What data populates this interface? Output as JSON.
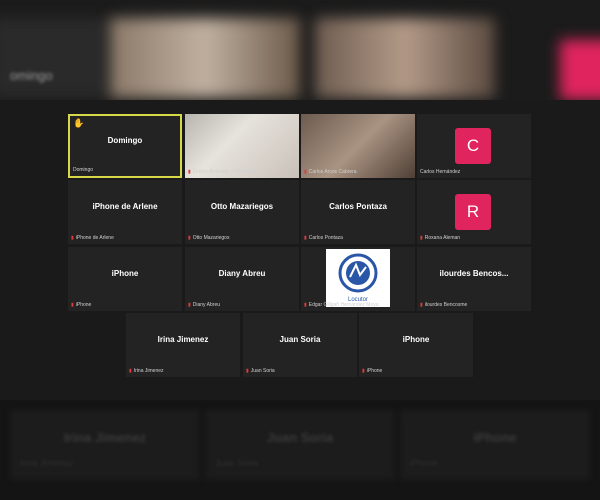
{
  "background_top": {
    "label": "omingo"
  },
  "background_bottom": {
    "tiles": [
      {
        "name": "Irina Jimenez",
        "label": "Irina Jimenez"
      },
      {
        "name": "Juan Soria",
        "label": "Juan Soria"
      },
      {
        "name": "iPhone",
        "label": "iPhone"
      }
    ]
  },
  "participants": [
    {
      "name": "Domingo",
      "label": "Domingo",
      "active": true,
      "hand": true
    },
    {
      "name": "",
      "label": "Evelyn Alvarado - CNAI UEB",
      "video": "a"
    },
    {
      "name": "",
      "label": "Carlos Arcos Cabrera",
      "video": "b"
    },
    {
      "name": "",
      "label": "Carlos Hernández",
      "avatar": "C"
    },
    {
      "name": "iPhone de Arlene",
      "label": "iPhone de Arlene"
    },
    {
      "name": "Otto Mazariegos",
      "label": "Otto Mazariegos"
    },
    {
      "name": "Carlos Pontaza",
      "label": "Carlos Pontaza"
    },
    {
      "name": "",
      "label": "Roxana Aleman",
      "avatar": "R"
    },
    {
      "name": "iPhone",
      "label": "iPhone"
    },
    {
      "name": "Diany Abreu",
      "label": "Diany Abreu"
    },
    {
      "name": "",
      "label": "Edgar Gillgañ Hernández Moya",
      "logo": true,
      "logo_text": "Locutor"
    },
    {
      "name": "ilourdes Bencos...",
      "label": "ilourdes Bencosme"
    },
    {
      "name": "Irina Jimenez",
      "label": "Irina Jimenez"
    },
    {
      "name": "Juan Soria",
      "label": "Juan Soria"
    },
    {
      "name": "iPhone",
      "label": "iPhone"
    }
  ],
  "colors": {
    "active_border": "#d6d84a",
    "avatar_bg": "#e0245e",
    "mic_muted": "#e23b3b",
    "hand": "#ffcc33"
  },
  "icons": {
    "muted": "mic-muted-icon",
    "raised_hand": "raised-hand-icon"
  }
}
